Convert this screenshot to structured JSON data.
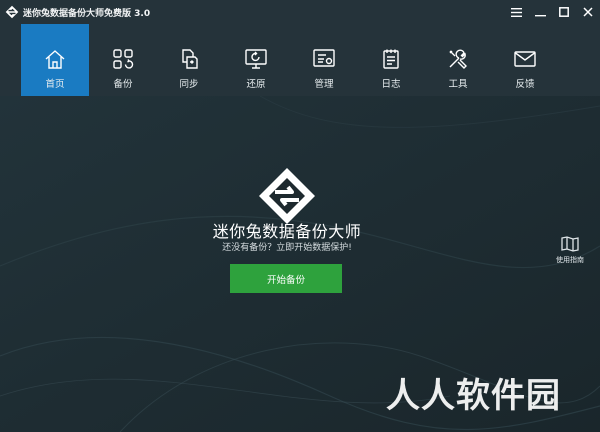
{
  "window": {
    "title": "迷你兔数据备份大师免费版 3.0",
    "controls": [
      "menu-icon",
      "minimize-icon",
      "maximize-icon",
      "close-icon"
    ]
  },
  "toolbar": {
    "items": [
      {
        "label": "首页",
        "icon": "home-icon",
        "active": true
      },
      {
        "label": "备份",
        "icon": "backup-grid-icon"
      },
      {
        "label": "同步",
        "icon": "sync-icon"
      },
      {
        "label": "还原",
        "icon": "restore-icon"
      },
      {
        "label": "管理",
        "icon": "manage-icon"
      },
      {
        "label": "日志",
        "icon": "log-icon"
      },
      {
        "label": "工具",
        "icon": "tools-icon"
      },
      {
        "label": "反馈",
        "icon": "feedback-icon"
      }
    ]
  },
  "main": {
    "app_name": "迷你兔数据备份大师",
    "subtitle": "还没有备份？立即开始数据保护!",
    "start_button": "开始备份",
    "guide_label": "使用指南"
  },
  "watermark": "人人软件园",
  "colors": {
    "titlebar_bg": "#25333a",
    "main_bg": "#1d292e",
    "active_tab": "#1a7bc2",
    "primary_button": "#2ea23d"
  }
}
